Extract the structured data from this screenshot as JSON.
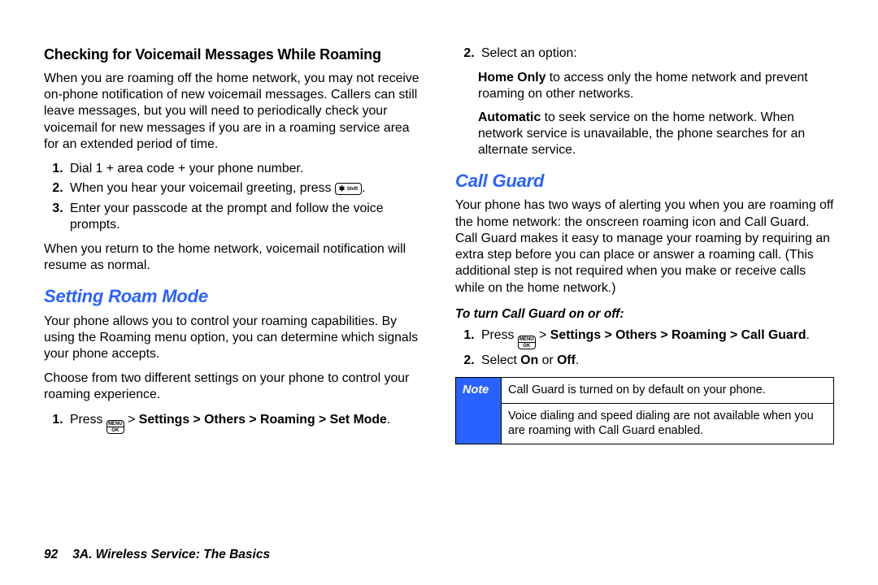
{
  "left": {
    "h_voicemail": "Checking for Voicemail Messages While Roaming",
    "p_voicemail": "When you are roaming off the home network, you may not receive on-phone notification of new voicemail messages. Callers can still leave messages, but you will need to periodically check your voicemail for new messages if you are in a roaming service area for an extended period of time.",
    "step1": "Dial 1 + area code + your phone number.",
    "step2a": "When you hear your voicemail greeting, press ",
    "step2b": ".",
    "step3": "Enter your passcode at the prompt and follow the voice prompts.",
    "p_resume": "When you return to the home network, voicemail notification will resume as normal.",
    "h_roam": "Setting Roam Mode",
    "p_roam1": "Your phone allows you to control your roaming capabilities. By using the Roaming menu option, you can determine which signals your phone accepts.",
    "p_roam2": "Choose from two different settings on your phone to control your roaming experience.",
    "roam_step1a": "Press ",
    "roam_step1b": " > ",
    "roam_path": "Settings > Others > Roaming > Set Mode",
    "roam_step1c": "."
  },
  "right": {
    "step2": "Select an option:",
    "opt_home_label": "Home Only",
    "opt_home_text": " to access only the home network and prevent roaming on other networks.",
    "opt_auto_label": "Automatic",
    "opt_auto_text": " to seek service on the home network. When network service is unavailable, the phone searches for an alternate service.",
    "h_callguard": "Call Guard",
    "p_callguard": "Your phone has two ways of alerting you when you are roaming off the home network: the onscreen roaming icon and Call Guard. Call Guard makes it easy to manage your roaming by requiring an extra step before you can place or answer a roaming call. (This additional step is not required when you make or receive calls while on the home network.)",
    "h_cg_instr": "To turn Call Guard on or off:",
    "cg_step1a": "Press ",
    "cg_step1b": " > ",
    "cg_path": "Settings > Others > Roaming > Call Guard",
    "cg_step1c": ".",
    "cg_step2a": "Select ",
    "cg_on": "On",
    "cg_or": " or ",
    "cg_off": "Off",
    "cg_step2b": ".",
    "note_label": "Note",
    "note_row1": "Call Guard is turned on by default on your phone.",
    "note_row2": "Voice dialing and speed dialing are not available when you are roaming with Call Guard enabled."
  },
  "keys": {
    "shift_star": "✱",
    "shift_label": "Shift",
    "menu_top": "MENU",
    "menu_bottom": "OK"
  },
  "footer": {
    "page": "92",
    "section": "3A. Wireless Service: The Basics"
  }
}
